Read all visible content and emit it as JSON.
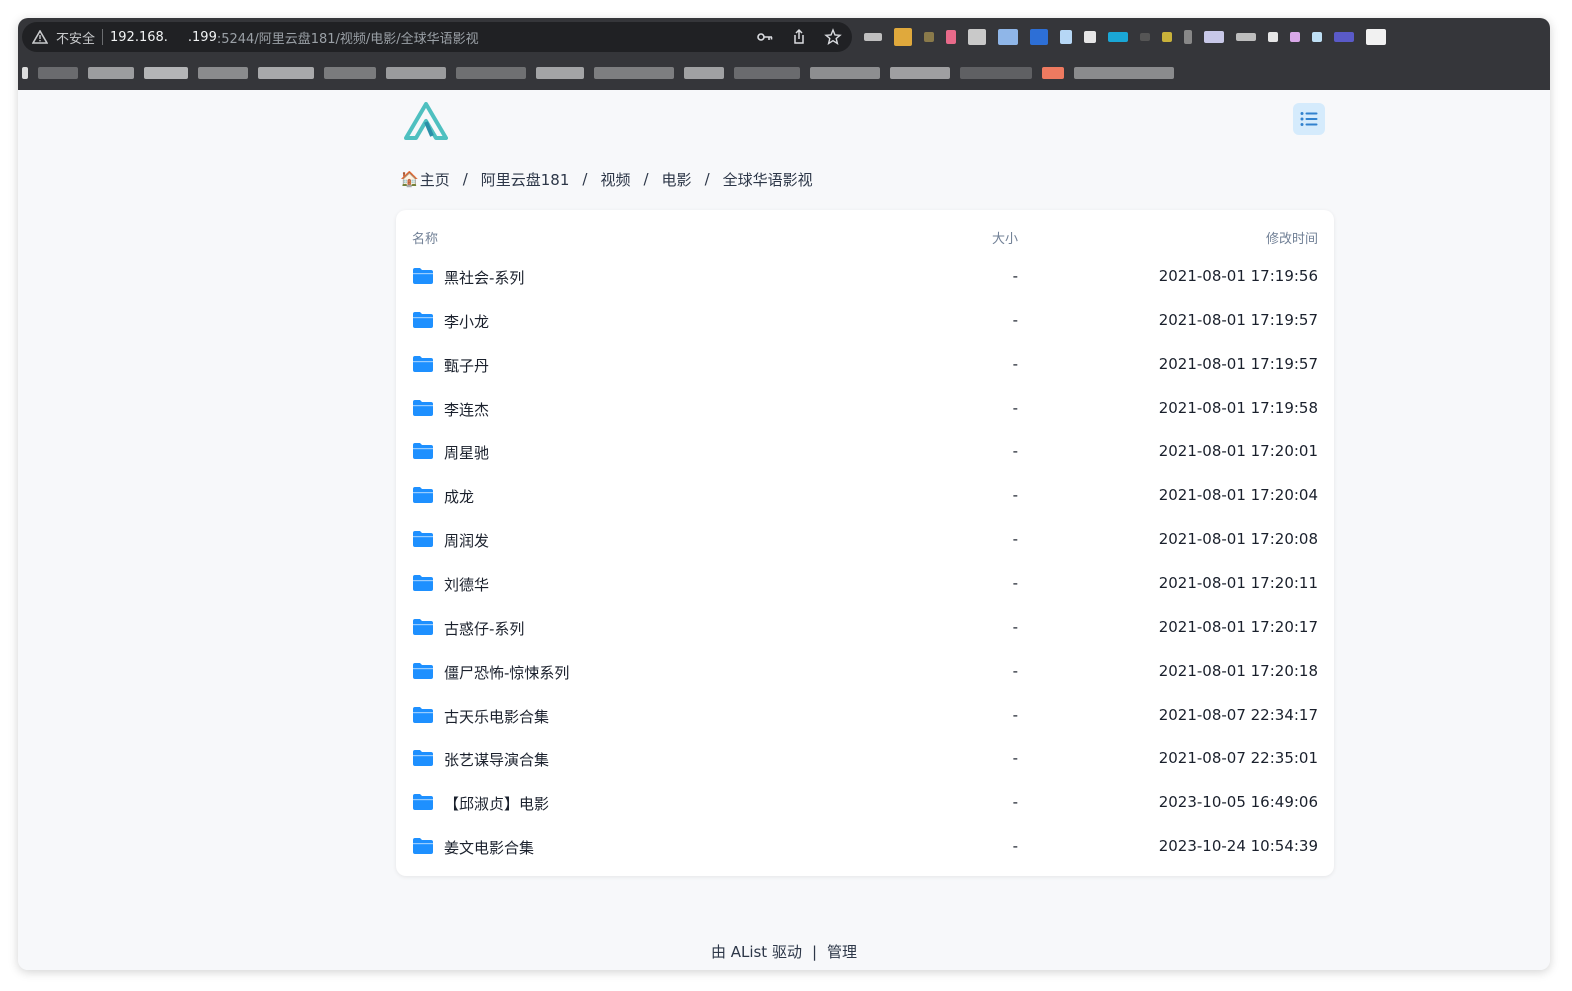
{
  "browser": {
    "security_label": "不安全",
    "url_host_left": "192.168.",
    "url_host_right": ".199",
    "url_path": ":5244/阿里云盘181/视频/电影/全球华语影视"
  },
  "breadcrumb": {
    "home_icon": "🏠",
    "items": [
      {
        "label": "主页"
      },
      {
        "label": "阿里云盘181"
      },
      {
        "label": "视频"
      },
      {
        "label": "电影"
      },
      {
        "label": "全球华语影视"
      }
    ],
    "separator": "/"
  },
  "table": {
    "headers": {
      "name": "名称",
      "size": "大小",
      "modified": "修改时间"
    },
    "rows": [
      {
        "name": "黑社会-系列",
        "size": "-",
        "modified": "2021-08-01 17:19:56"
      },
      {
        "name": "李小龙",
        "size": "-",
        "modified": "2021-08-01 17:19:57"
      },
      {
        "name": "甄子丹",
        "size": "-",
        "modified": "2021-08-01 17:19:57"
      },
      {
        "name": "李连杰",
        "size": "-",
        "modified": "2021-08-01 17:19:58"
      },
      {
        "name": "周星驰",
        "size": "-",
        "modified": "2021-08-01 17:20:01"
      },
      {
        "name": "成龙",
        "size": "-",
        "modified": "2021-08-01 17:20:04"
      },
      {
        "name": "周润发",
        "size": "-",
        "modified": "2021-08-01 17:20:08"
      },
      {
        "name": "刘德华",
        "size": "-",
        "modified": "2021-08-01 17:20:11"
      },
      {
        "name": "古惑仔-系列",
        "size": "-",
        "modified": "2021-08-01 17:20:17"
      },
      {
        "name": "僵尸恐怖-惊悚系列",
        "size": "-",
        "modified": "2021-08-01 17:20:18"
      },
      {
        "name": "古天乐电影合集",
        "size": "-",
        "modified": "2021-08-07 22:34:17"
      },
      {
        "name": "张艺谋导演合集",
        "size": "-",
        "modified": "2021-08-07 22:35:01"
      },
      {
        "name": "【邱淑贞】电影",
        "size": "-",
        "modified": "2023-10-05 16:49:06"
      },
      {
        "name": "姜文电影合集",
        "size": "-",
        "modified": "2023-10-24 10:54:39"
      }
    ]
  },
  "footer": {
    "powered_by": "由 AList 驱动",
    "separator": "|",
    "manage": "管理"
  },
  "colors": {
    "folder": "#1e90ff",
    "accent_bg": "#d5ebfc",
    "accent": "#3182ce",
    "logo": "#4fc0c0"
  },
  "icons": {
    "logo": "alist-logo",
    "toggle": "list-view-icon",
    "folder": "folder-icon"
  }
}
